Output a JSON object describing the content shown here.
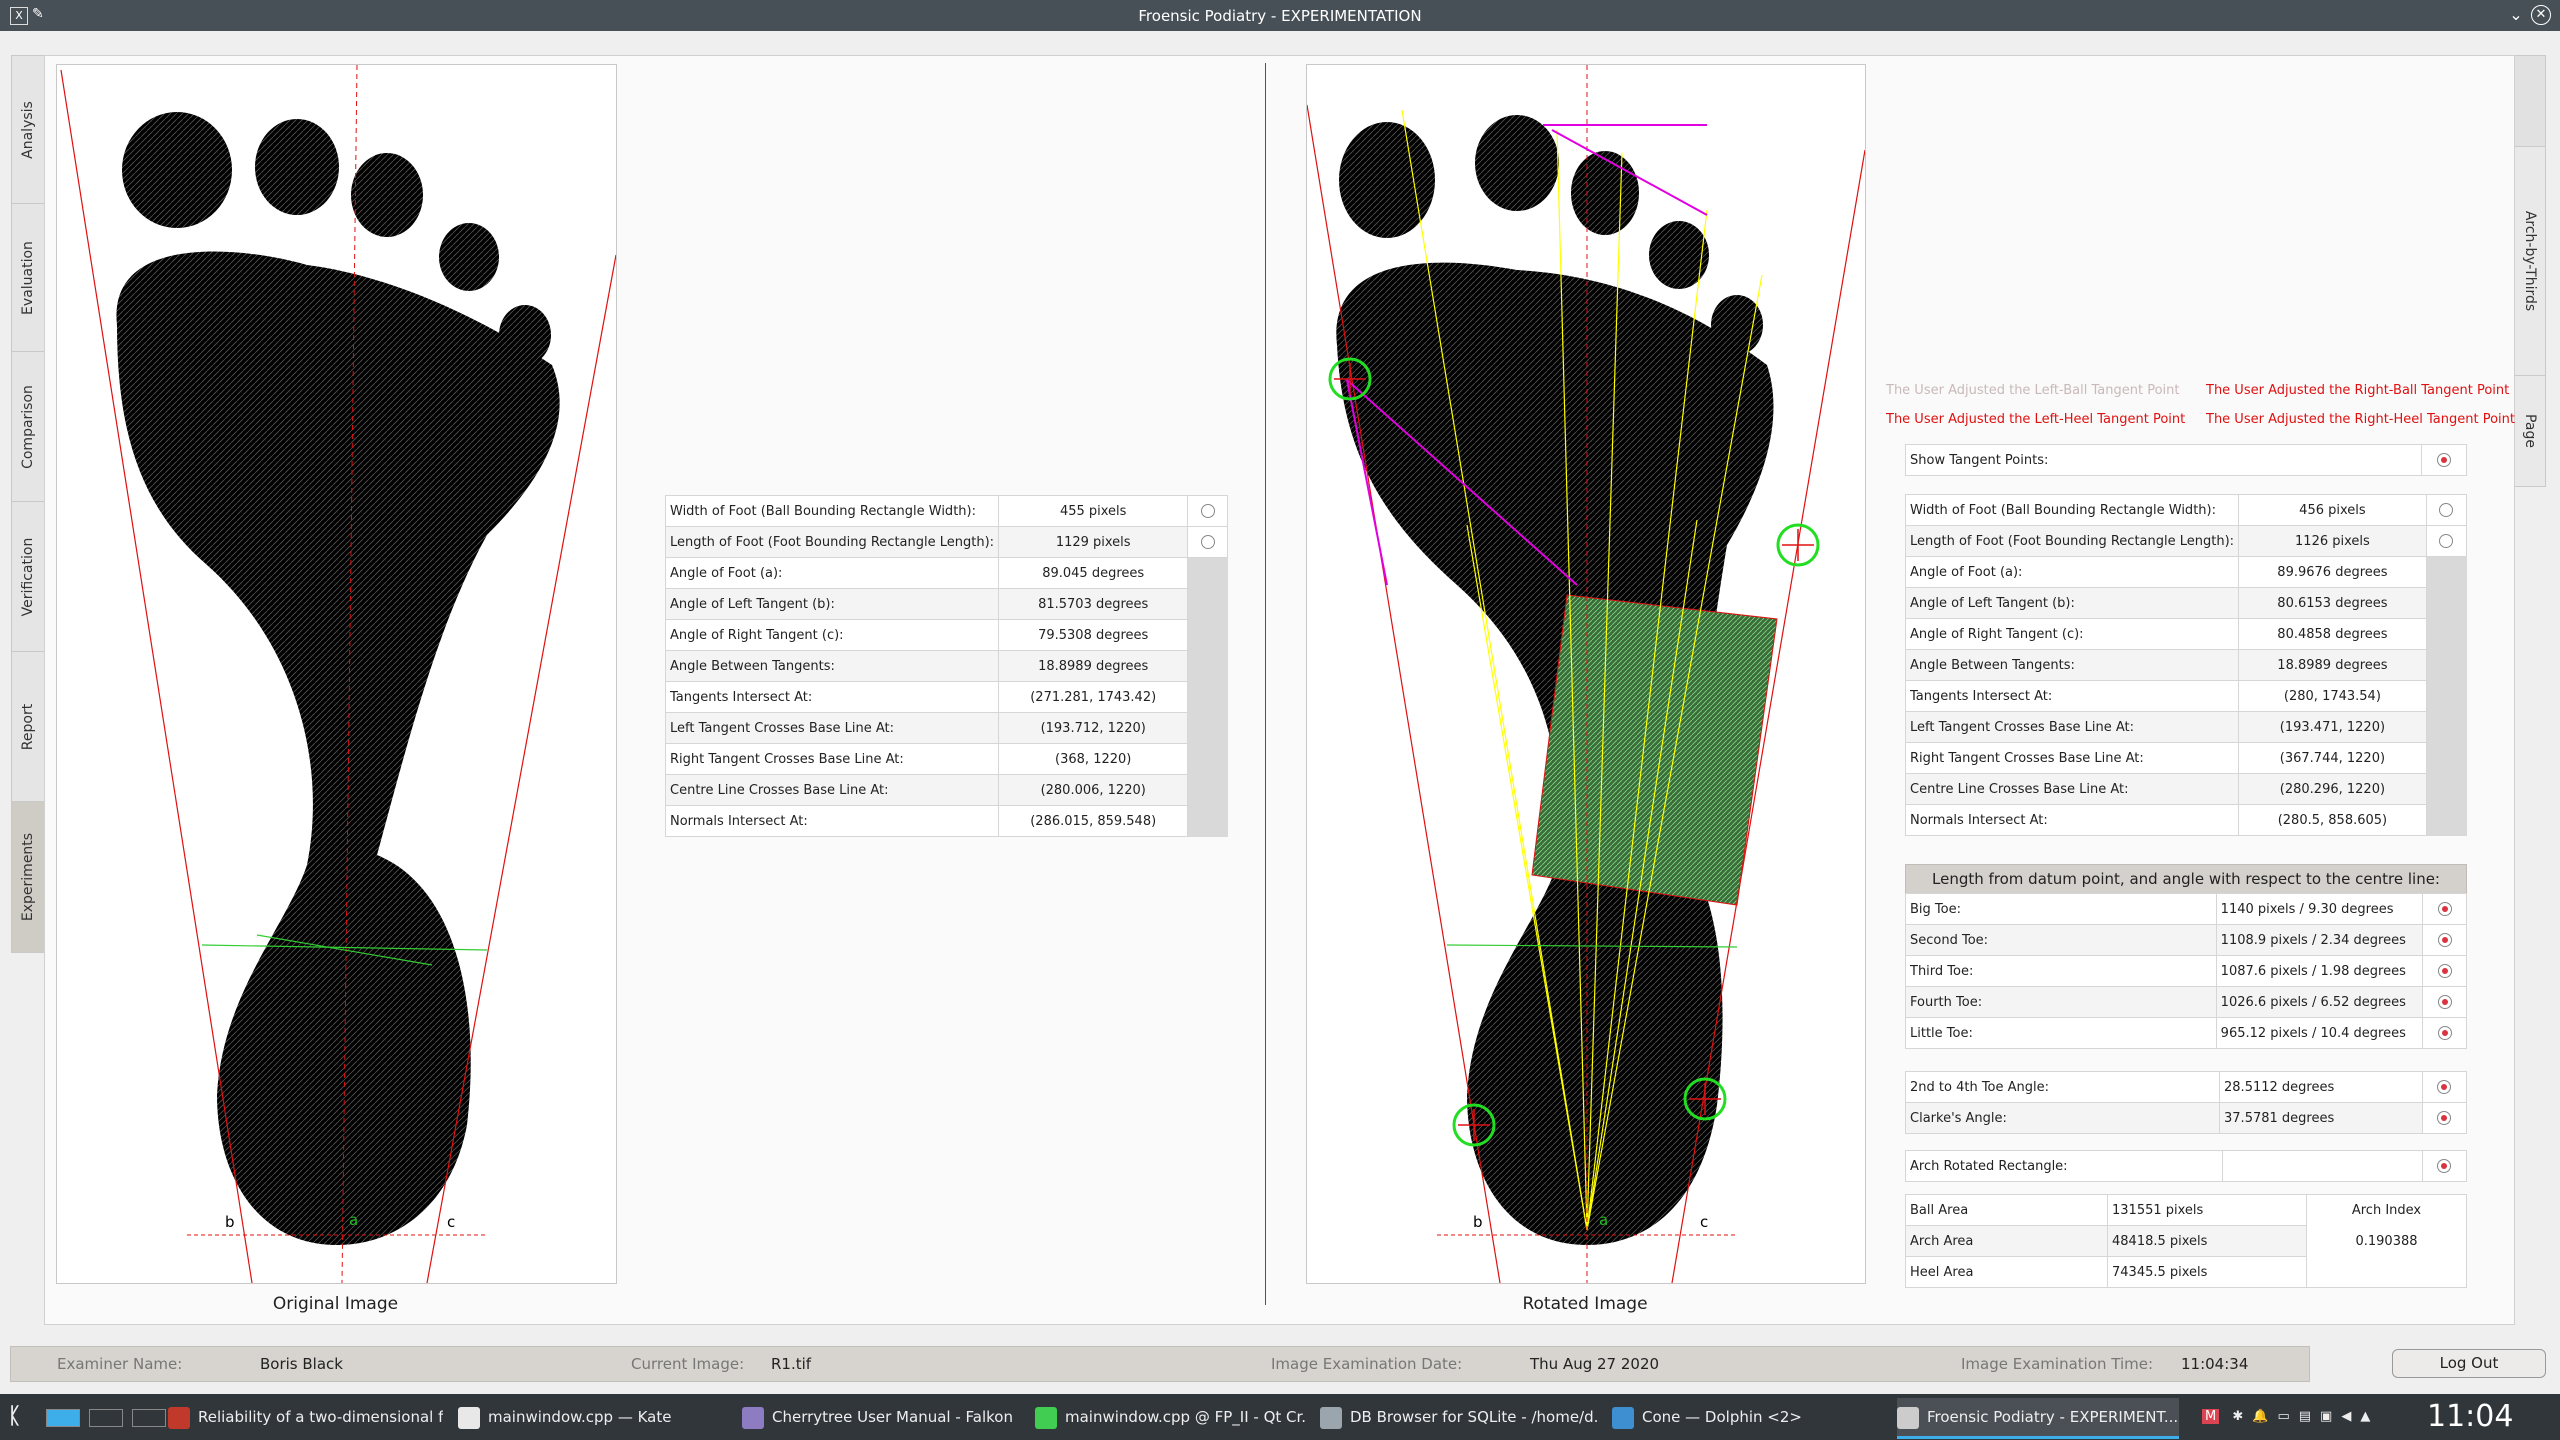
{
  "window": {
    "title": "Froensic Podiatry - EXPERIMENTATION",
    "app_icon": "X",
    "pin_icon": "pin-icon",
    "min_glyph": "⌄",
    "max_glyph": "⌃",
    "close_glyph": "✕"
  },
  "left_tabs": [
    "Analysis",
    "Evaluation",
    "Comparison",
    "Verification",
    "Report",
    "Experiments"
  ],
  "right_tabs": [
    "Arch-by-Thirds",
    "Page"
  ],
  "images": {
    "original_caption": "Original Image",
    "rotated_caption": "Rotated Image",
    "marker_b": "b",
    "marker_a": "a",
    "marker_c": "c"
  },
  "left_table": {
    "rows": [
      {
        "label": "Width of Foot (Ball Bounding Rectangle Width):",
        "value": "455 pixels",
        "radio": "off"
      },
      {
        "label": "Length of Foot (Foot Bounding Rectangle Length):",
        "value": "1129 pixels",
        "radio": "off"
      },
      {
        "label": "Angle of Foot (a):",
        "value": "89.045 degrees"
      },
      {
        "label": "Angle of Left Tangent (b):",
        "value": "81.5703 degrees"
      },
      {
        "label": "Angle of Right Tangent (c):",
        "value": "79.5308 degrees"
      },
      {
        "label": "Angle Between Tangents:",
        "value": "18.8989 degrees"
      },
      {
        "label": "Tangents Intersect At:",
        "value": "(271.281, 1743.42)"
      },
      {
        "label": "Left Tangent Crosses Base Line At:",
        "value": "(193.712, 1220)"
      },
      {
        "label": "Right Tangent Crosses Base Line At:",
        "value": "(368, 1220)"
      },
      {
        "label": "Centre Line Crosses Base Line At:",
        "value": "(280.006, 1220)"
      },
      {
        "label": "Normals Intersect At:",
        "value": "(286.015, 859.548)"
      }
    ]
  },
  "tangent_points": {
    "left_ball": "The User Adjusted the Left-Ball Tangent Point",
    "right_ball": "The User Adjusted the Right-Ball Tangent Point",
    "left_heel": "The User Adjusted the Left-Heel Tangent Point",
    "right_heel": "The User Adjusted the Right-Heel Tangent Point"
  },
  "show_tangent": {
    "label": "Show Tangent Points:"
  },
  "right_table": {
    "rows": [
      {
        "label": "Width of Foot (Ball Bounding Rectangle Width):",
        "value": "456 pixels",
        "radio": "off"
      },
      {
        "label": "Length of Foot (Foot Bounding Rectangle Length):",
        "value": "1126 pixels",
        "radio": "off"
      },
      {
        "label": "Angle of Foot (a):",
        "value": "89.9676 degrees"
      },
      {
        "label": "Angle of Left Tangent (b):",
        "value": "80.6153 degrees"
      },
      {
        "label": "Angle of Right Tangent (c):",
        "value": "80.4858 degrees"
      },
      {
        "label": "Angle Between Tangents:",
        "value": "18.8989 degrees"
      },
      {
        "label": "Tangents Intersect At:",
        "value": "(280, 1743.54)"
      },
      {
        "label": "Left Tangent Crosses Base Line At:",
        "value": "(193.471, 1220)"
      },
      {
        "label": "Right Tangent Crosses Base Line At:",
        "value": "(367.744, 1220)"
      },
      {
        "label": "Centre Line Crosses Base Line At:",
        "value": "(280.296, 1220)"
      },
      {
        "label": "Normals Intersect At:",
        "value": "(280.5, 858.605)"
      }
    ]
  },
  "toe_section": {
    "header": "Length from datum point, and angle with respect to the centre line:",
    "rows": [
      {
        "label": "Big Toe:",
        "value": "1140 pixels  /  9.30 degrees"
      },
      {
        "label": "Second Toe:",
        "value": "1108.9 pixels  /  2.34 degrees"
      },
      {
        "label": "Third Toe:",
        "value": "1087.6 pixels  /  1.98 degrees"
      },
      {
        "label": "Fourth Toe:",
        "value": "1026.6 pixels  /  6.52 degrees"
      },
      {
        "label": "Little Toe:",
        "value": "965.12 pixels  /  10.4 degrees"
      }
    ]
  },
  "angles": [
    {
      "label": "2nd to 4th Toe Angle:",
      "value": "28.5112 degrees"
    },
    {
      "label": "Clarke's Angle:",
      "value": "37.5781 degrees"
    }
  ],
  "arch_rect": {
    "label": "Arch Rotated Rectangle:",
    "value": ""
  },
  "areas": {
    "rows": [
      {
        "label": "Ball Area",
        "value": "131551 pixels"
      },
      {
        "label": "Arch Area",
        "value": "48418.5 pixels"
      },
      {
        "label": "Heel Area",
        "value": "74345.5 pixels"
      }
    ],
    "index_label": "Arch Index",
    "index_value": "0.190388"
  },
  "status": {
    "examiner_label": "Examiner Name:",
    "examiner_value": "Boris Black",
    "image_label": "Current Image:",
    "image_value": "R1.tif",
    "date_label": "Image Examination Date:",
    "date_value": "Thu Aug 27 2020",
    "time_label": "Image Examination Time:",
    "time_value": "11:04:34",
    "logout": "Log Out"
  },
  "taskbar": {
    "items": [
      {
        "label": "Reliability of a two-dimensional f...",
        "icon": "pdf-icon",
        "color": "#c0392b"
      },
      {
        "label": "mainwindow.cpp  — Kate",
        "icon": "kate-icon",
        "color": "#e8e8e8"
      },
      {
        "label": "Cherrytree User Manual - Falkon",
        "icon": "falkon-icon",
        "color": "#8e7cc3"
      },
      {
        "label": "mainwindow.cpp @ FP_II - Qt Cr...",
        "icon": "qtcreator-icon",
        "color": "#41cd52"
      },
      {
        "label": "DB Browser for SQLite - /home/d...",
        "icon": "sqlite-icon",
        "color": "#9aa5ad"
      },
      {
        "label": "Cone — Dolphin <2>",
        "icon": "dolphin-icon",
        "color": "#3d8fd1"
      },
      {
        "label": "Froensic Podiatry - EXPERIMENT...",
        "icon": "app-icon",
        "color": "#cccccc"
      }
    ],
    "clock": "11:04"
  },
  "colors": {
    "accent": "#3daee9",
    "tangent_red": "#e01010",
    "centre_line": "#e01010",
    "toe_lines": "#ffff00",
    "magenta": "#e000e0",
    "arch_green": "#33cc33"
  }
}
